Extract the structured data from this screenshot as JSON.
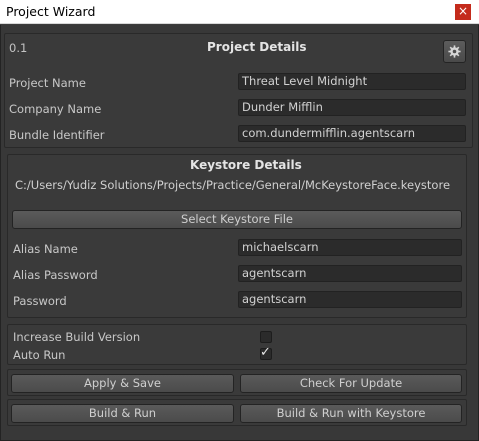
{
  "window": {
    "title": "Project Wizard",
    "close_label": "×",
    "accent_close": "#c42b1c"
  },
  "project": {
    "version": "0.1",
    "section_title": "Project Details",
    "settings_icon": "gear-icon",
    "name_label": "Project Name",
    "name_value": "Threat Level Midnight",
    "company_label": "Company Name",
    "company_value": "Dunder Mifflin",
    "bundle_label": "Bundle Identifier",
    "bundle_value": "com.dundermifflin.agentscarn"
  },
  "keystore": {
    "section_title": "Keystore Details",
    "path": "C:/Users/Yudiz Solutions/Projects/Practice/General/McKeystoreFace.keystore",
    "select_button": "Select Keystore File",
    "alias_name_label": "Alias Name",
    "alias_name_value": "michaelscarn",
    "alias_password_label": "Alias Password",
    "alias_password_value": "agentscarn",
    "password_label": "Password",
    "password_value": "agentscarn"
  },
  "options": {
    "increase_build_label": "Increase Build Version",
    "increase_build_checked": false,
    "auto_run_label": "Auto Run",
    "auto_run_checked": true,
    "checkmark": "✓"
  },
  "actions": {
    "apply_save": "Apply & Save",
    "check_update": "Check For Update",
    "build_run": "Build & Run",
    "build_run_keystore": "Build & Run with Keystore"
  }
}
